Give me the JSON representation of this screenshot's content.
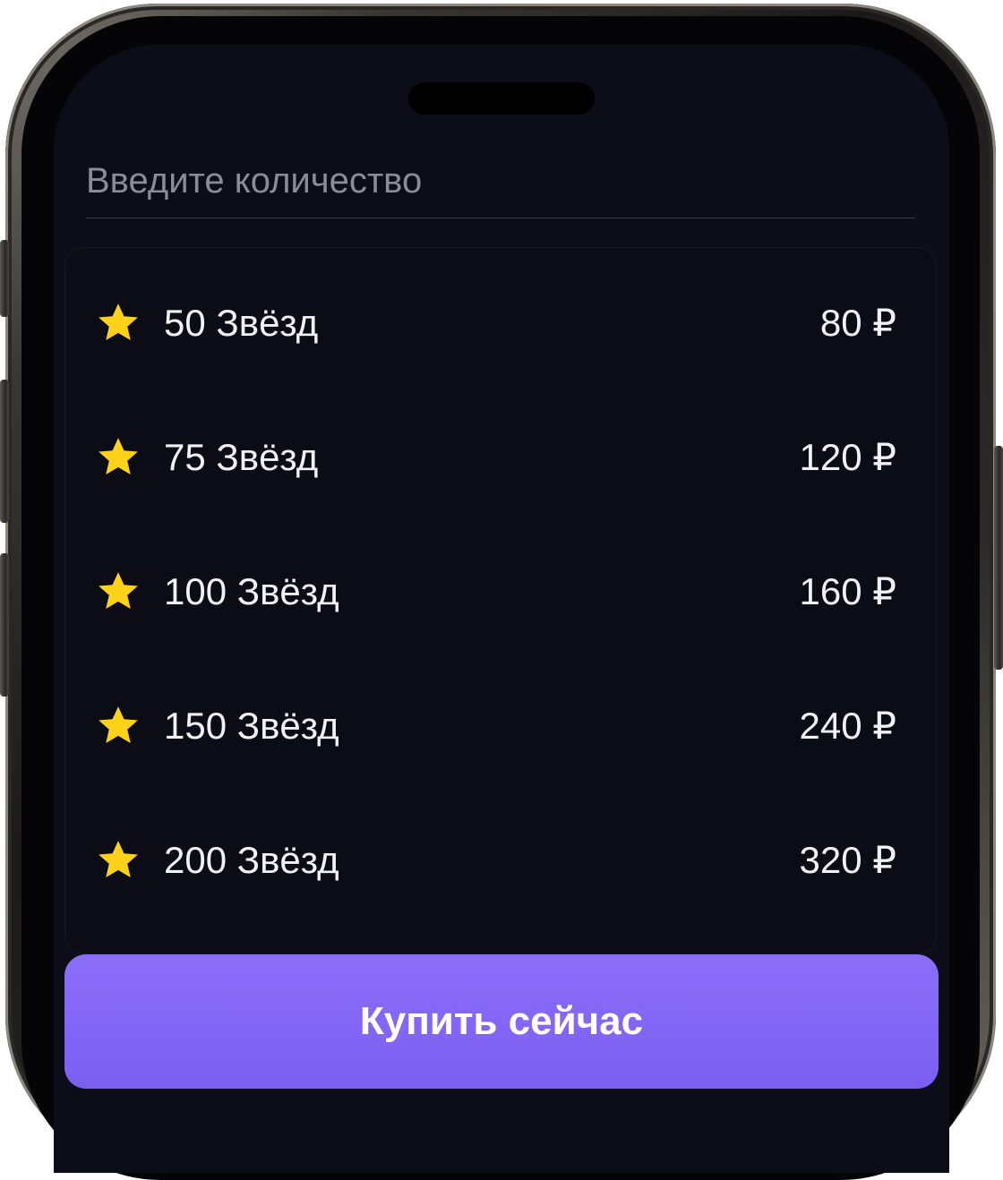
{
  "quantity_input": {
    "placeholder": "Введите количество",
    "value": ""
  },
  "options": [
    {
      "label": "50 Звёзд",
      "price": "80 ₽"
    },
    {
      "label": "75 Звёзд",
      "price": "120 ₽"
    },
    {
      "label": "100 Звёзд",
      "price": "160 ₽"
    },
    {
      "label": "150 Звёзд",
      "price": "240 ₽"
    },
    {
      "label": "200 Звёзд",
      "price": "320 ₽"
    }
  ],
  "icons": {
    "option": "star-icon"
  },
  "buy_button": {
    "label": "Купить сейчас"
  },
  "colors": {
    "screen_background": "#0c0d18",
    "star": "#ffd21a",
    "accent": "#8469f5",
    "text": "#f2f2f6",
    "placeholder": "#8a8c98"
  }
}
